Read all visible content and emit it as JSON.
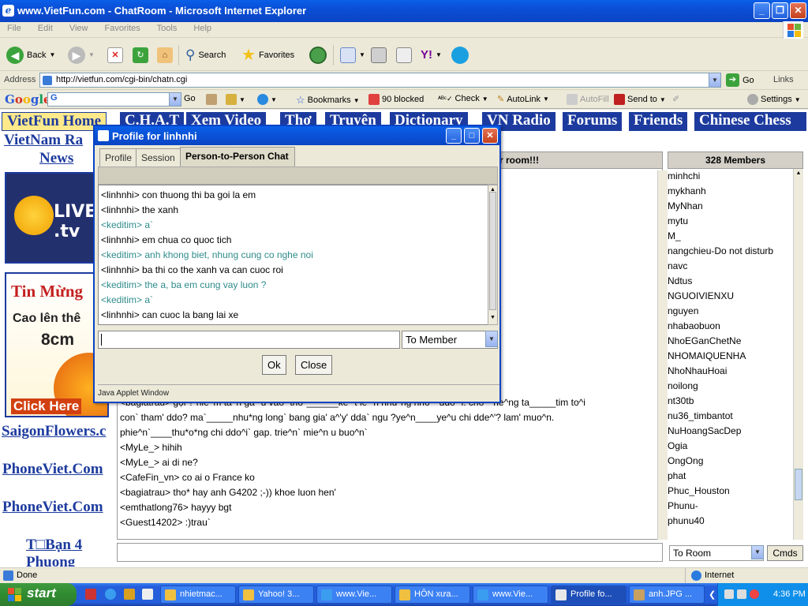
{
  "window": {
    "title": "www.VietFun.com - ChatRoom - Microsoft Internet Explorer"
  },
  "menu": [
    "File",
    "Edit",
    "View",
    "Favorites",
    "Tools",
    "Help"
  ],
  "toolbar": {
    "back": "Back",
    "search": "Search",
    "favorites": "Favorites"
  },
  "address": {
    "label": "Address",
    "url": "http://vietfun.com/cgi-bin/chatn.cgi",
    "go": "Go",
    "links": "Links"
  },
  "google": {
    "logo": "Google",
    "go": "Go",
    "bookmarks": "Bookmarks",
    "blocked": "90 blocked",
    "check": "Check",
    "autolink": "AutoLink",
    "autofill": "AutoFill",
    "sendto": "Send to",
    "settings": "Settings"
  },
  "site": {
    "tabs": [
      "VietFun Home",
      "C.H.A.T",
      "Xem Video",
      "Thơ",
      "Truyện",
      "Dictionary",
      "VN Radio",
      "Forums",
      "Friends",
      "Chinese Chess"
    ],
    "left_links": [
      "VietNam Ra",
      "News",
      "SaigonFlowers.c",
      "PhoneViet.Com",
      "PhoneViet.Com",
      "T□Bạn 4",
      "Phuong"
    ],
    "banner1_text": "LIVE .tv",
    "banner2": {
      "title": "Tin Mừng",
      "line1": "Cao lên thê",
      "line2": "8cm",
      "cta": "Click Here"
    },
    "room_header": "r room!!!",
    "chat_lines": [
      "<bagiatrau> gọi ? nie^m ta^n ga^'u  vao` tho*______ke^'t le^'n nhu*ng nho*` ddo^'i. cho*` rie^ng ta_____tim to^i",
      "   con` tham' ddo? ma`_____nhu*ng long` bang gia' a^'y' dda` ngu ?ye^n____ye^u chi dde^'? lam' muo^n.",
      "   phie^n`____thu*o*ng chi ddo^i` gap. trie^n` mie^n u buo^n`",
      "<MyLe_> hihih",
      "<MyLe_> ai di ne?",
      "<CafeFin_vn> co ai o France ko",
      "<bagiatrau> tho* hay anh G4202 ;-)) khoe luon hen'",
      "<emthatlong76> hayyy bgt",
      "<Guest14202> :)trau`"
    ],
    "members_header": "328 Members",
    "members": [
      "minhchi",
      "mykhanh",
      "MyNhan",
      "mytu",
      "M_",
      "nangchieu-Do not disturb",
      "navc",
      "Ndtus",
      "NGUOIVIENXU",
      "nguyen",
      "nhabaobuon",
      "NhoEGanChetNe",
      "NHOMAIQUENHA",
      "NhoNhauHoai",
      "noilong",
      "nt30tb",
      "nu36_timbantot",
      "NuHoangSacDep",
      "Ogia",
      "OngOng",
      "phat",
      "Phuc_Houston",
      "Phunu-",
      "phunu40"
    ],
    "room_select": "To Room",
    "cmds": "Cmds"
  },
  "dialog": {
    "title": "Profile for linhnhi",
    "tabs": [
      "Profile",
      "Session",
      "Person-to-Person Chat"
    ],
    "lines": [
      {
        "text": "<linhnhi>  con thuong thi ba goi la em",
        "me": false
      },
      {
        "text": "<linhnhi>  the xanh",
        "me": false
      },
      {
        "text": "<keditim> a`",
        "me": true
      },
      {
        "text": "<linhnhi>  em chua co quoc tich",
        "me": false
      },
      {
        "text": "<keditim> anh khong biet, nhung cung co nghe noi",
        "me": true
      },
      {
        "text": "<linhnhi>  ba thi co the xanh va can cuoc roi",
        "me": false
      },
      {
        "text": "<keditim> the a, ba em cung vay luon ?",
        "me": true
      },
      {
        "text": "<keditim> a`",
        "me": true
      },
      {
        "text": "<linhnhi>  can cuoc la bang lai xe",
        "me": false
      }
    ],
    "recipient": "To Member",
    "ok": "Ok",
    "close": "Close",
    "footer": "Java Applet Window"
  },
  "status": {
    "text": "Done",
    "zone": "Internet"
  },
  "taskbar": {
    "start": "start",
    "tasks": [
      "nhietmac...",
      "Yahoo! 3...",
      "www.Vie...",
      "HÔN xưa...",
      "www.Vie...",
      "Profile fo...",
      "anh.JPG ..."
    ],
    "active_index": 5,
    "clock": "4:36 PM"
  }
}
